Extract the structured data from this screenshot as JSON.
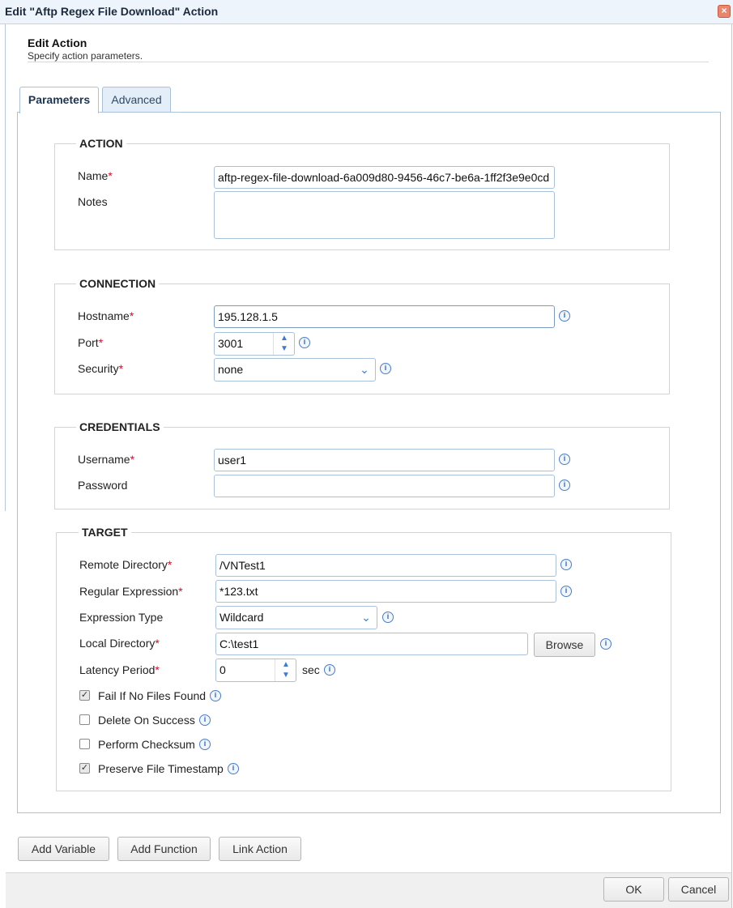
{
  "window": {
    "title": "Edit \"Aftp Regex File Download\" Action",
    "close_glyph": "×"
  },
  "header": {
    "title": "Edit Action",
    "subtitle": "Specify action parameters."
  },
  "tabs": [
    {
      "label": "Parameters",
      "active": true
    },
    {
      "label": "Advanced",
      "active": false
    }
  ],
  "action": {
    "legend": "ACTION",
    "name_label": "Name",
    "name_value": "aftp-regex-file-download-6a009d80-9456-46c7-be6a-1ff2f3e9e0cd",
    "notes_label": "Notes",
    "notes_value": ""
  },
  "connection": {
    "legend": "CONNECTION",
    "hostname_label": "Hostname",
    "hostname_value": "195.128.1.5",
    "port_label": "Port",
    "port_value": "3001",
    "security_label": "Security",
    "security_value": "none"
  },
  "credentials": {
    "legend": "CREDENTIALS",
    "username_label": "Username",
    "username_value": "user1",
    "password_label": "Password",
    "password_value": ""
  },
  "target": {
    "legend": "TARGET",
    "remote_dir_label": "Remote Directory",
    "remote_dir_value": "/VNTest1",
    "regex_label": "Regular Expression",
    "regex_value": "*123.txt",
    "expr_type_label": "Expression Type",
    "expr_type_value": "Wildcard",
    "local_dir_label": "Local Directory",
    "local_dir_value": "C:\\test1",
    "browse_label": "Browse",
    "latency_label": "Latency Period",
    "latency_value": "0",
    "latency_unit": "sec",
    "checkboxes": [
      {
        "label": "Fail If No Files Found",
        "checked": true
      },
      {
        "label": "Delete On Success",
        "checked": false
      },
      {
        "label": "Perform Checksum",
        "checked": false
      },
      {
        "label": "Preserve File Timestamp",
        "checked": true
      }
    ]
  },
  "actions_bar": {
    "add_variable": "Add Variable",
    "add_function": "Add Function",
    "link_action": "Link Action"
  },
  "footer": {
    "ok": "OK",
    "cancel": "Cancel"
  },
  "glyphs": {
    "required": "*",
    "info": "i",
    "check": "✓",
    "chevron_down": "⌄",
    "spin_up": "▲",
    "spin_down": "▼"
  },
  "colors": {
    "accent": "#3b7bd4",
    "required": "#c8102e",
    "border": "#a9c1d9"
  }
}
